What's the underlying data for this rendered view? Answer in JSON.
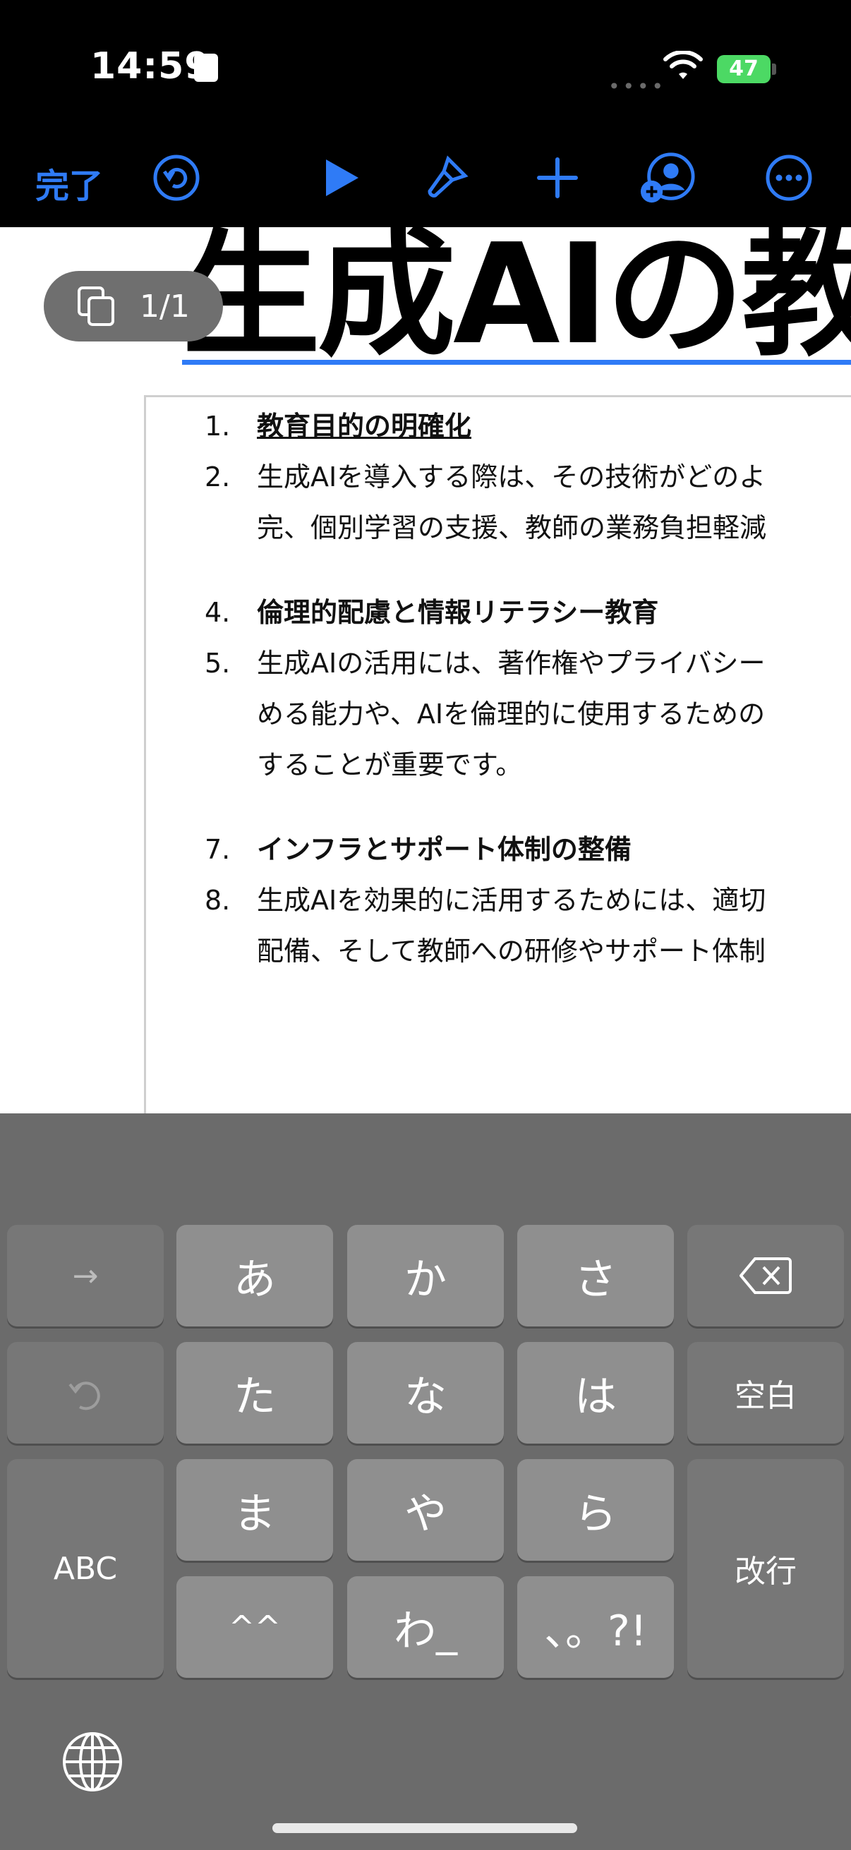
{
  "status_bar": {
    "time": "14:59",
    "battery": "47"
  },
  "toolbar": {
    "done_label": "完了",
    "icons": [
      "undo-icon",
      "play-icon",
      "paintbrush-icon",
      "add-icon",
      "collaborate-icon",
      "more-icon"
    ]
  },
  "document": {
    "title": "生成AIの教",
    "page_indicator": "1/1",
    "items": [
      {
        "num": "1.",
        "text": "教育目的の明確化",
        "bold": true
      },
      {
        "num": "2.",
        "text": "生成AIを導入する際は、その技術がどのよ",
        "bold": false
      },
      {
        "num": "",
        "text": "完、個別学習の支援、教師の業務負担軽減",
        "bold": false
      },
      {
        "num": "4.",
        "text": "倫理的配慮と情報リテラシー教育",
        "bold": true
      },
      {
        "num": "5.",
        "text": "生成AIの活用には、著作権やプライバシー",
        "bold": false
      },
      {
        "num": "",
        "text": "める能力や、AIを倫理的に使用するための",
        "bold": false
      },
      {
        "num": "",
        "text": "することが重要です。",
        "bold": false
      },
      {
        "num": "7.",
        "text": "インフラとサポート体制の整備",
        "bold": true
      },
      {
        "num": "8.",
        "text": "生成AIを効果的に活用するためには、適切",
        "bold": false
      },
      {
        "num": "",
        "text": "配備、そして教師への研修やサポート体制",
        "bold": false
      }
    ]
  },
  "keyboard": {
    "row1": [
      "→",
      "あ",
      "か",
      "さ",
      "delete-icon"
    ],
    "row2": [
      "undo",
      "た",
      "な",
      "は",
      "空白"
    ],
    "row3": [
      "ABC",
      "ま",
      "や",
      "ら",
      "改行"
    ],
    "row4": [
      "^^",
      "わ_",
      "、。?!"
    ],
    "globe": "globe-icon"
  }
}
